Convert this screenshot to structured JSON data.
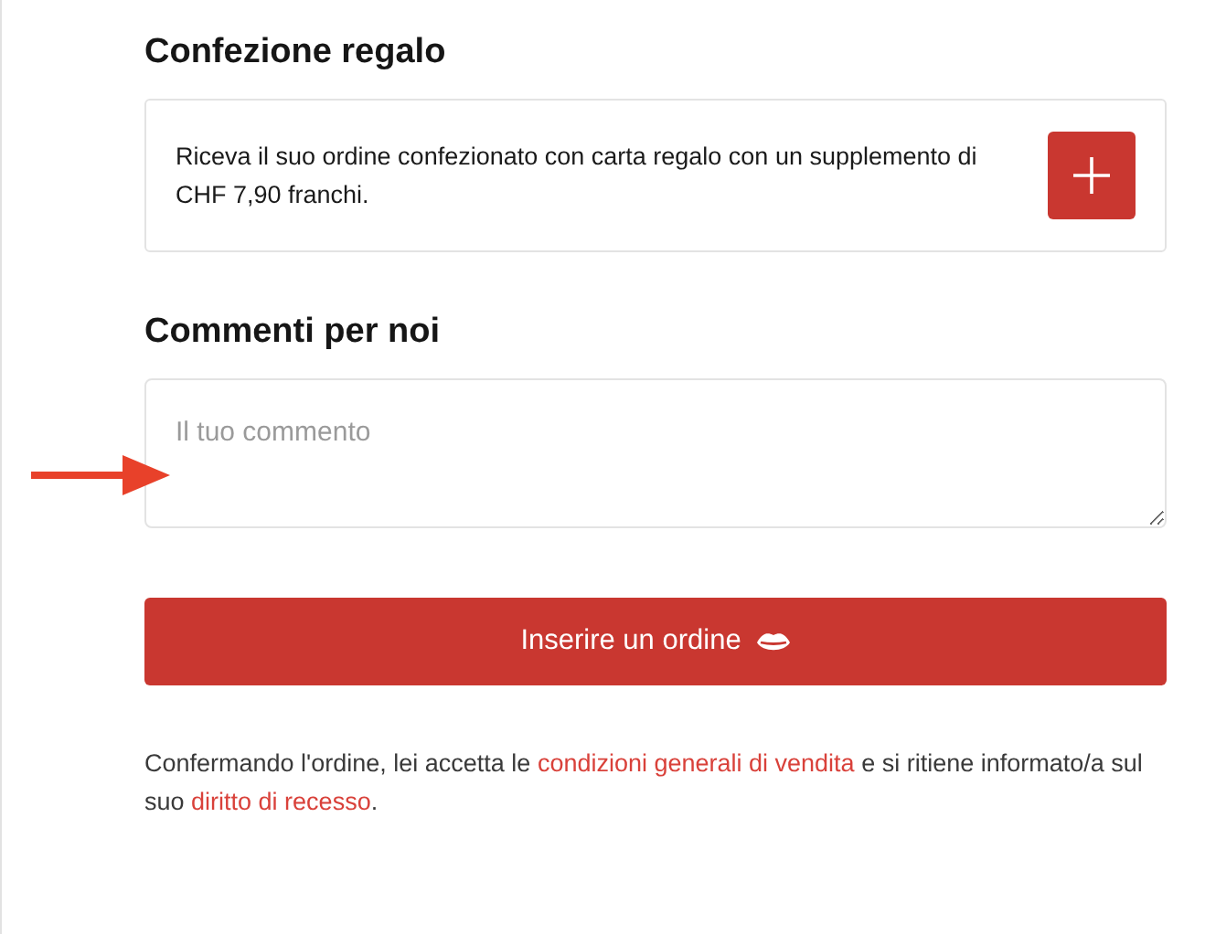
{
  "gift_wrap": {
    "heading": "Confezione regalo",
    "description": "Riceva il suo ordine confezionato con carta regalo con un supplemento di CHF 7,90 franchi."
  },
  "comments": {
    "heading": "Commenti per noi",
    "placeholder": "Il tuo commento"
  },
  "submit_button": {
    "label": "Inserire un ordine"
  },
  "legal_notice": [
    {
      "kind": "text",
      "text": "Confermando l'ordine, lei accetta le "
    },
    {
      "kind": "link",
      "text": "condizioni generali di vendita"
    },
    {
      "kind": "text",
      "text": " e si ritiene informato/a sul suo "
    },
    {
      "kind": "link",
      "text": "diritto di recesso"
    },
    {
      "kind": "text",
      "text": "."
    }
  ]
}
